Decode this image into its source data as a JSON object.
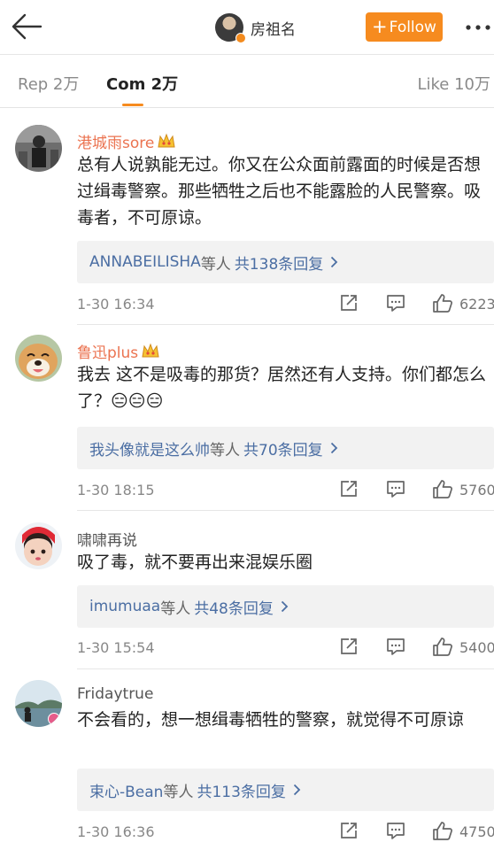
{
  "header": {
    "username": "房祖名",
    "follow_label": "Follow",
    "icons": {
      "back": "back-arrow-icon",
      "more": "more-dots-icon",
      "verified": "verified-badge-icon"
    },
    "follow_color": "#f68b1f"
  },
  "tabs": [
    {
      "label": "Rep 2万",
      "active": false
    },
    {
      "label": "Com 2万",
      "active": true
    },
    {
      "label": "Like 10万",
      "active": false
    }
  ],
  "comments": [
    {
      "name": "港城雨sore",
      "text": "总有人说孰能无过。你又在公众面前露面的时候是否想过缉毒警察。那些牺牲之后也不能露脸的人民警察。吸毒者，不可原谅。",
      "reply_user": "ANNABEILISHA",
      "reply_suffix": "等人",
      "reply_count": "共138条回复",
      "time": "1-30 16:34",
      "likes": "6223"
    },
    {
      "name": "鲁迅plus",
      "text": "我去 这不是吸毒的那货？居然还有人支持。你们都怎么了？😑😑😑",
      "reply_user": "我头像就是这么帅",
      "reply_suffix": "等人",
      "reply_count": "共70条回复",
      "time": "1-30 18:15",
      "likes": "5760"
    },
    {
      "name": "啸啸再说",
      "text": "吸了毒，就不要再出来混娱乐圈",
      "reply_user": "imumuaa",
      "reply_suffix": "等人",
      "reply_count": "共48条回复",
      "time": "1-30 15:54",
      "likes": "5400"
    },
    {
      "name": "Fridaytrue",
      "text": "不会看的，想一想缉毒牺牲的警察，就觉得不可原谅",
      "reply_user": "束心-Bean",
      "reply_suffix": "等人",
      "reply_count": "共113条回复",
      "time": "1-30 16:36",
      "likes": "4750"
    }
  ],
  "action_icons": [
    "share-icon",
    "comment-icon",
    "like-thumb-icon"
  ],
  "colors": {
    "accent": "#f68b1f",
    "name": "#eb7350",
    "link": "#4b6ea3"
  }
}
